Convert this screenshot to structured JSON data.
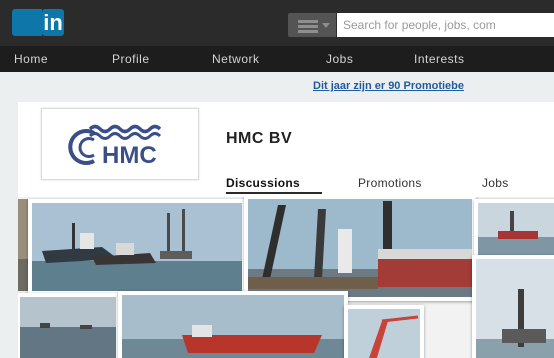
{
  "header": {
    "logo_text": "in",
    "search_placeholder": "Search for people, jobs, com"
  },
  "nav": {
    "items": [
      "Home",
      "Profile",
      "Network",
      "Jobs",
      "Interests"
    ]
  },
  "promo": {
    "text": "Dit jaar zijn er 90 Promotiebe"
  },
  "company": {
    "logo_text": "HMC",
    "name": "HMC BV",
    "tabs": [
      "Discussions",
      "Promotions",
      "Jobs"
    ],
    "active_tab": "Discussions"
  },
  "colors": {
    "topbar": "#2b2b2b",
    "nav": "#1d1d1d",
    "linkedin_blue": "#0e76a8",
    "promo_link": "#1f5c9e",
    "hmc_blue": "#3a4f8a"
  }
}
